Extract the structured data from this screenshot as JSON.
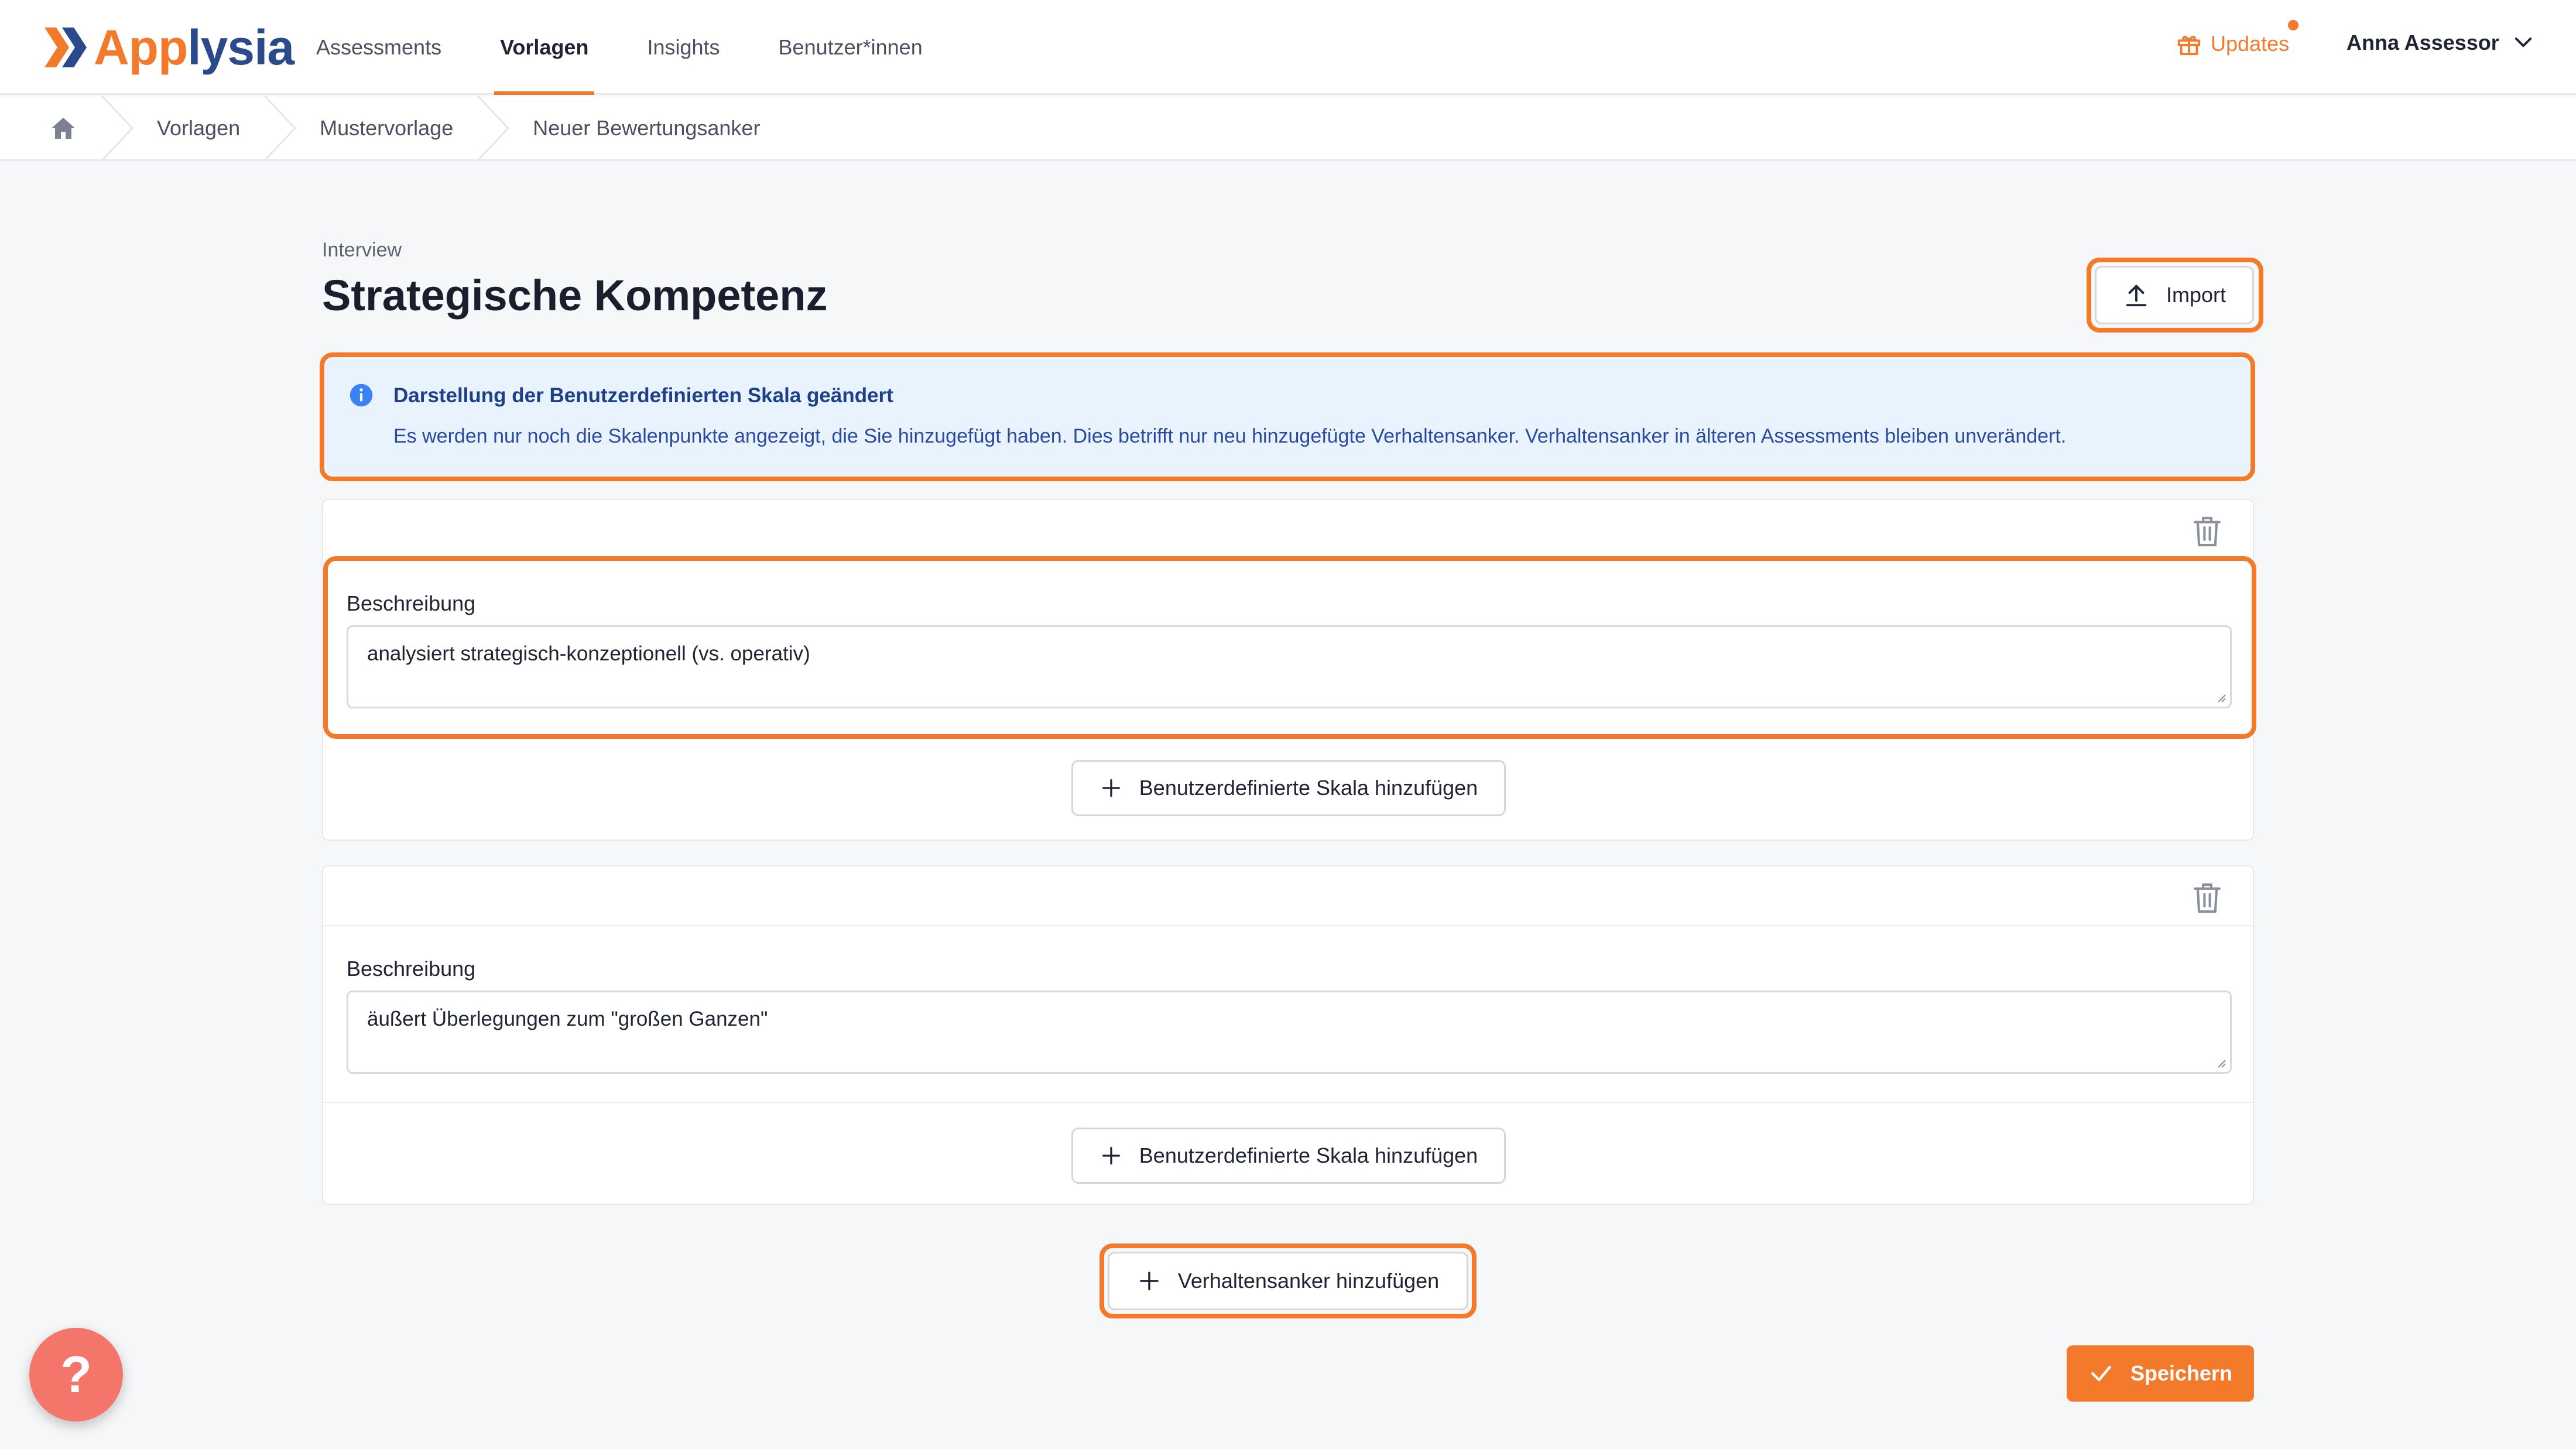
{
  "app": {
    "logo_part1": "App",
    "logo_part2": "lysia"
  },
  "nav": {
    "items": [
      {
        "label": "Assessments",
        "active": false
      },
      {
        "label": "Vorlagen",
        "active": true
      },
      {
        "label": "Insights",
        "active": false
      },
      {
        "label": "Benutzer*innen",
        "active": false
      }
    ],
    "updates_label": "Updates",
    "user_name": "Anna Assessor"
  },
  "breadcrumb": {
    "items": [
      "Vorlagen",
      "Mustervorlage",
      "Neuer Bewertungsanker"
    ]
  },
  "page": {
    "eyebrow": "Interview",
    "title": "Strategische Kompetenz",
    "import_label": "Import"
  },
  "info": {
    "title": "Darstellung der Benutzerdefinierten Skala geändert",
    "text": "Es werden nur noch die Skalenpunkte angezeigt, die Sie hinzugefügt haben. Dies betrifft nur neu hinzugefügte Verhaltensanker. Verhaltensanker in älteren Assessments bleiben unverändert."
  },
  "anchors": [
    {
      "description_label": "Beschreibung",
      "description_value": "analysiert strategisch-konzeptionell (vs. operativ)",
      "add_scale_label": "Benutzerdefinierte Skala hinzufügen"
    },
    {
      "description_label": "Beschreibung",
      "description_value": "äußert Überlegungen zum \"großen Ganzen\"",
      "add_scale_label": "Benutzerdefinierte Skala hinzufügen"
    }
  ],
  "actions": {
    "add_anchor_label": "Verhaltensanker hinzufügen",
    "save_label": "Speichern",
    "help_label": "?"
  },
  "colors": {
    "accent": "#f37a2b",
    "brand_blue": "#2a4a8b",
    "info_bg": "#e9f3fd",
    "help": "#f4766a"
  }
}
